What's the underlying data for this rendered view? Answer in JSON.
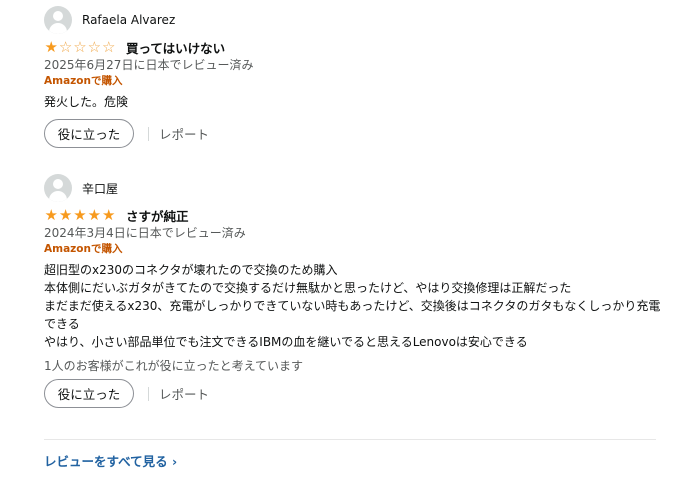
{
  "reviews": [
    {
      "profile_name": "Rafaela Alvarez",
      "rating": 1,
      "stars": [
        "★",
        "☆",
        "☆",
        "☆",
        "☆"
      ],
      "title": "買ってはいけない",
      "date": "2025年6月27日に日本でレビュー済み",
      "verified": "Amazonで購入",
      "body": "発火した。危険",
      "helpful_text": "",
      "helpful_button": "役に立った",
      "report": "レポート"
    },
    {
      "profile_name": "辛口屋",
      "rating": 5,
      "stars": [
        "★",
        "★",
        "★",
        "★",
        "★"
      ],
      "title": "さすが純正",
      "date": "2024年3月4日に日本でレビュー済み",
      "verified": "Amazonで購入",
      "body": "超旧型のx230のコネクタが壊れたので交換のため購入\n本体側にだいぶガタがきてたので交換するだけ無駄かと思ったけど、やはり交換修理は正解だった\nまだまだ使えるx230、充電がしっかりできていない時もあったけど、交換後はコネクタのガタもなくしっかり充電できる\nやはり、小さい部品単位でも注文できるIBMの血を継いでると思えるLenovoは安心できる",
      "helpful_text": "1人のお客様がこれが役に立ったと考えています",
      "helpful_button": "役に立った",
      "report": "レポート"
    }
  ],
  "see_all": "レビューをすべて見る ›",
  "colors": {
    "star": "#f79a1e",
    "verified": "#c45500",
    "link": "#2162a1",
    "muted": "#565959"
  }
}
